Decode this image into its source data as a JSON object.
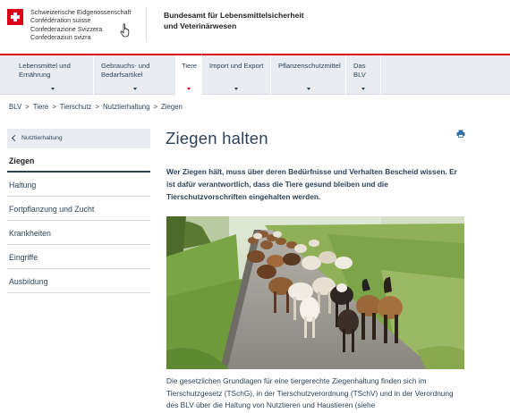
{
  "header": {
    "confederation": [
      "Schweizerische Eidgenossenschaft",
      "Confédération suisse",
      "Confederazione Svizzera",
      "Confederaziun svizra"
    ],
    "office_line1": "Bundesamt für Lebensmittelsicherheit",
    "office_line2": "und Veterinärwesen"
  },
  "mainnav": {
    "items": [
      {
        "line1": "Lebensmittel und",
        "line2": "Ernährung"
      },
      {
        "line1": "Gebrauchs- und",
        "line2": "Bedarfsartikel"
      },
      {
        "line1": "Tiere",
        "line2": ""
      },
      {
        "line1": "Import und Export",
        "line2": ""
      },
      {
        "line1": "Pflanzenschutzmittel",
        "line2": ""
      },
      {
        "line1": "Das BLV",
        "line2": ""
      }
    ],
    "active_index": 2
  },
  "breadcrumb": {
    "items": [
      "BLV",
      "Tiere",
      "Tierschutz",
      "Nutztierhaltung",
      "Ziegen"
    ],
    "separator": ">"
  },
  "sidebar": {
    "back_label": "Nutztierhaltung",
    "items": [
      {
        "label": "Ziegen",
        "active": true
      },
      {
        "label": "Haltung",
        "active": false
      },
      {
        "label": "Fortpflanzung und Zucht",
        "active": false
      },
      {
        "label": "Krankheiten",
        "active": false
      },
      {
        "label": "Eingriffe",
        "active": false
      },
      {
        "label": "Ausbildung",
        "active": false
      }
    ]
  },
  "content": {
    "title": "Ziegen halten",
    "lead": "Wer Ziegen hält, muss über deren Bedürfnisse und Verhalten Bescheid wissen. Er ist dafür verantwortlich, dass die Tiere gesund bleiben und die Tierschutzvorschriften eingehalten werden.",
    "body": "Die gesetzlichen Grundlagen für eine tiergerechte Ziegenhaltung finden sich im Tierschutzgesetz (TSchG), in der Tierschutzverordnung (TSchV) und in der Verordnung des BLV über die Haltung von Nutztieren und Haustieren (siehe"
  },
  "colors": {
    "brand_red": "#dc0018",
    "text_blue": "#2f4356",
    "nav_bg": "#e9edf1"
  },
  "icons": {
    "swiss_cross": "swiss-cross-icon",
    "print": "print-icon",
    "back": "chevron-left-icon",
    "nav_expand": "chevron-down-icon"
  }
}
